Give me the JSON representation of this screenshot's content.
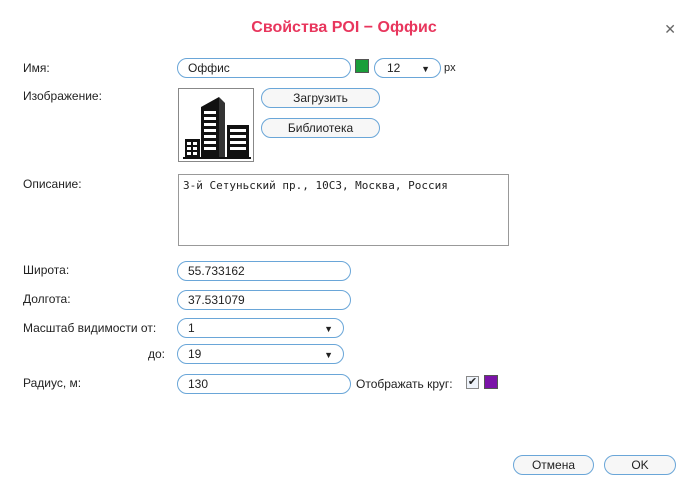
{
  "dialog": {
    "title": "Свойства POI − Оффис",
    "close_icon": "close-icon"
  },
  "name": {
    "label": "Имя:",
    "value": "Оффис",
    "color": "#1a9e3a",
    "font_size_value": "12",
    "font_size_unit": "px"
  },
  "image": {
    "label": "Изображение:",
    "icon": "building-icon",
    "upload_label": "Загрузить",
    "library_label": "Библиотека"
  },
  "description": {
    "label": "Описание:",
    "value": "3-й Сетуньский пр., 10С3, Москва, Россия"
  },
  "latitude": {
    "label": "Широта:",
    "value": "55.733162"
  },
  "longitude": {
    "label": "Долгота:",
    "value": "37.531079"
  },
  "zoom": {
    "from_label": "Масштаб видимости от:",
    "from_value": "1",
    "to_label": "до:",
    "to_value": "19"
  },
  "radius": {
    "label": "Радиус, м:",
    "value": "130",
    "show_circle_label": "Отображать круг:",
    "show_circle_checked": true,
    "circle_color": "#7b13a8"
  },
  "footer": {
    "cancel_label": "Отмена",
    "ok_label": "OK"
  },
  "colors": {
    "title": "#e8365d",
    "field_border": "#6aa6d8"
  }
}
